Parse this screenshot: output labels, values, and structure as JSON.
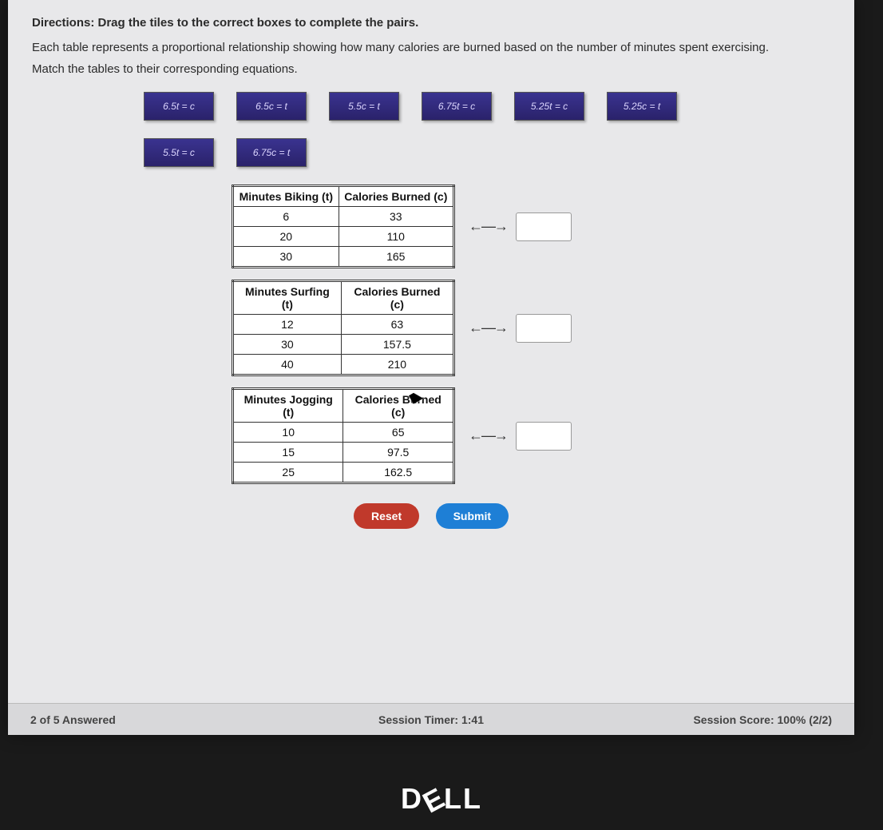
{
  "directions": "Directions: Drag the tiles to the correct boxes to complete the pairs.",
  "intro": "Each table represents a proportional relationship showing how many calories are burned based on the number of minutes spent exercising.",
  "instruction": "Match the tables to their corresponding equations.",
  "tiles": {
    "row1": [
      "6.5t = c",
      "6.5c = t",
      "5.5c = t",
      "6.75t = c",
      "5.25t = c",
      "5.25c = t"
    ],
    "row2": [
      "5.5t = c",
      "6.75c = t"
    ]
  },
  "tables": [
    {
      "col1_header": "Minutes Biking (t)",
      "col2_header": "Calories Burned (c)",
      "rows": [
        [
          "6",
          "33"
        ],
        [
          "20",
          "110"
        ],
        [
          "30",
          "165"
        ]
      ]
    },
    {
      "col1_header": "Minutes Surfing (t)",
      "col2_header": "Calories Burned (c)",
      "rows": [
        [
          "12",
          "63"
        ],
        [
          "30",
          "157.5"
        ],
        [
          "40",
          "210"
        ]
      ]
    },
    {
      "col1_header": "Minutes Jogging (t)",
      "col2_header": "Calories Burned (c)",
      "rows": [
        [
          "10",
          "65"
        ],
        [
          "15",
          "97.5"
        ],
        [
          "25",
          "162.5"
        ]
      ]
    }
  ],
  "buttons": {
    "reset": "Reset",
    "submit": "Submit"
  },
  "footer": {
    "answered": "2 of 5 Answered",
    "timer": "Session Timer: 1:41",
    "score": "Session Score: 100% (2/2)"
  },
  "brand": "DELL"
}
